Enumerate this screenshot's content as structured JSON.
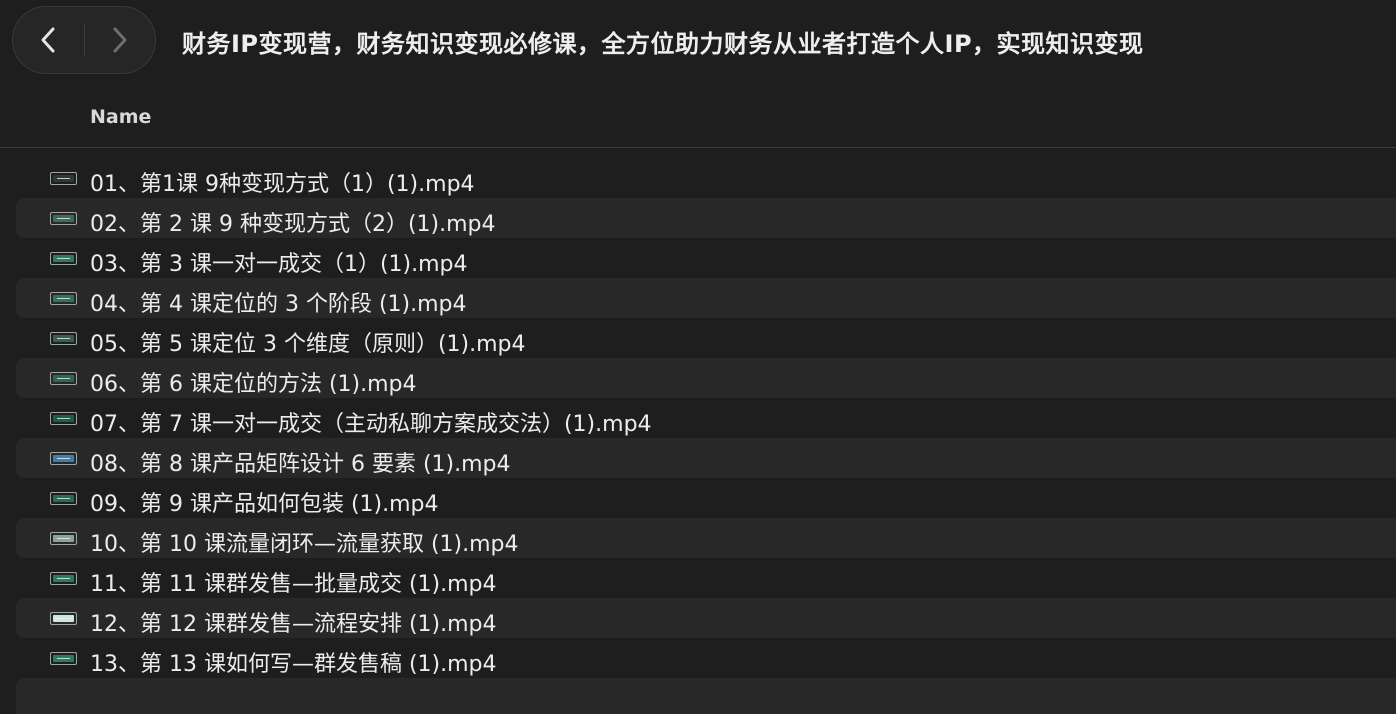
{
  "window": {
    "title": "财务IP变现营，财务知识变现必修课，全方位助力财务从业者打造个人IP，实现知识变现"
  },
  "nav": {
    "back_icon": "chevron-left-icon",
    "forward_icon": "chevron-right-icon"
  },
  "columns": {
    "name": "Name"
  },
  "files": [
    {
      "name": "01、第1课 9种变现方式（1）(1).mp4",
      "thumb": "#2c3a36"
    },
    {
      "name": "02、第 2 课 9 种变现方式（2）(1).mp4",
      "thumb": "#3f6b5c"
    },
    {
      "name": "03、第 3 课一对一成交（1）(1).mp4",
      "thumb": "#2f7b62"
    },
    {
      "name": "04、第 4 课定位的 3 个阶段 (1).mp4",
      "thumb": "#2e7460"
    },
    {
      "name": "05、第 5 课定位 3 个维度（原则）(1).mp4",
      "thumb": "#3a5e55"
    },
    {
      "name": "06、第 6 课定位的方法 (1).mp4",
      "thumb": "#2b6857"
    },
    {
      "name": "07、第 7 课一对一成交（主动私聊方案成交法）(1).mp4",
      "thumb": "#1f5c4a"
    },
    {
      "name": "08、第 8 课产品矩阵设计 6 要素 (1).mp4",
      "thumb": "#3d7fb0"
    },
    {
      "name": "09、第 9 课产品如何包装 (1).mp4",
      "thumb": "#2b6a58"
    },
    {
      "name": "10、第 10 课流量闭环—流量获取 (1).mp4",
      "thumb": "#8aa49c"
    },
    {
      "name": "11、第 11 课群发售—批量成交 (1).mp4",
      "thumb": "#2d7a63"
    },
    {
      "name": "12、第 12 课群发售—流程安排 (1).mp4",
      "thumb": "#cfe6df"
    },
    {
      "name": "13、第 13 课如何写—群发售稿 (1).mp4",
      "thumb": "#2e7b63"
    }
  ]
}
